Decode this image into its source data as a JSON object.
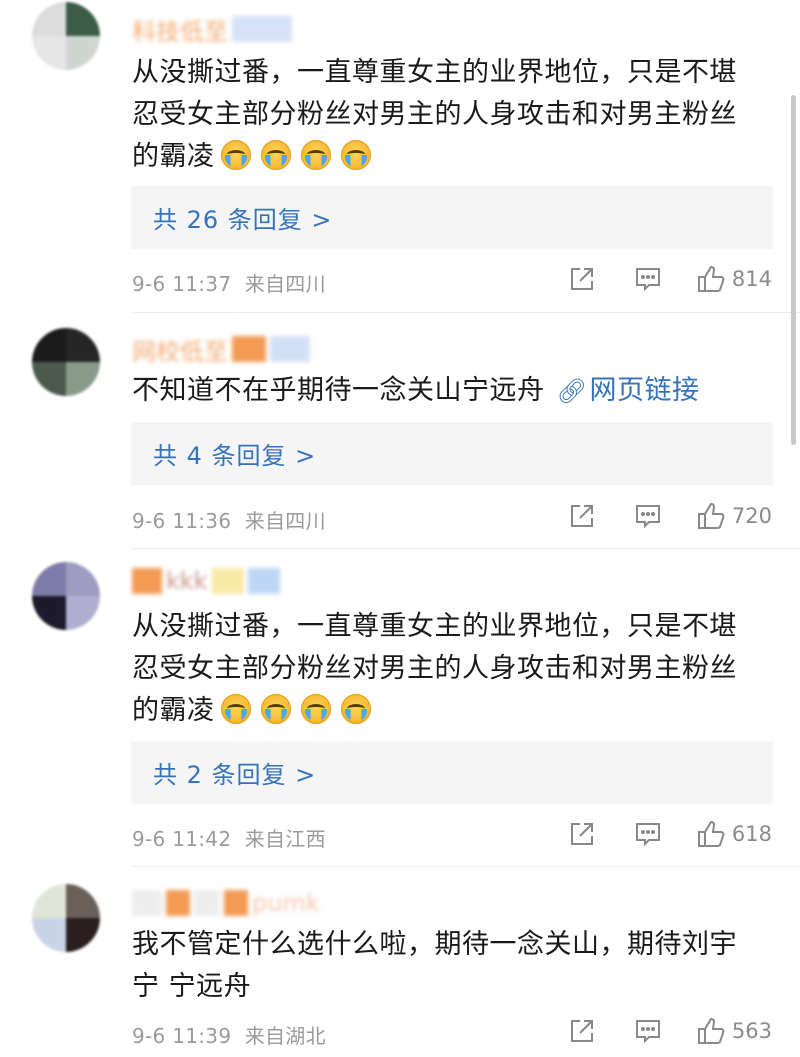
{
  "comments": [
    {
      "username": "科技低至",
      "text_lines": [
        "从没撕过番，一直尊重女主的业界地位，只是不堪",
        "忍受女主部分粉丝对男主的人身攻击和对男主粉丝",
        "的霸凌"
      ],
      "emoji": "loudly-crying-face",
      "emoji_count": 4,
      "replies": "共 26 条回复 >",
      "time": "9-6 11:37",
      "location": "来自四川",
      "likes": "814"
    },
    {
      "username": "网校低至",
      "text": "不知道不在乎期待一念关山宁远舟",
      "link_icon": "link-icon",
      "link_text": "网页链接",
      "replies": "共 4 条回复 >",
      "time": "9-6 11:36",
      "location": "来自四川",
      "likes": "720"
    },
    {
      "username": "kkk",
      "text_lines": [
        "从没撕过番，一直尊重女主的业界地位，只是不堪",
        "忍受女主部分粉丝对男主的人身攻击和对男主粉丝",
        "的霸凌"
      ],
      "emoji": "loudly-crying-face",
      "emoji_count": 4,
      "replies": "共 2 条回复 >",
      "time": "9-6 11:42",
      "location": "来自江西",
      "likes": "618"
    },
    {
      "username": "pumk",
      "text_lines": [
        "我不管定什么选什么啦，期待一念关山，期待刘宇",
        "宁 宁远舟"
      ],
      "time": "9-6 11:39",
      "location": "来自湖北",
      "likes": "563"
    }
  ],
  "icons": {
    "share": "share-icon",
    "comment": "comment-icon",
    "like": "like-icon"
  },
  "colors": {
    "link": "#3573b9",
    "meta": "#9a9a9a",
    "reply_bg": "#f5f5f5"
  }
}
